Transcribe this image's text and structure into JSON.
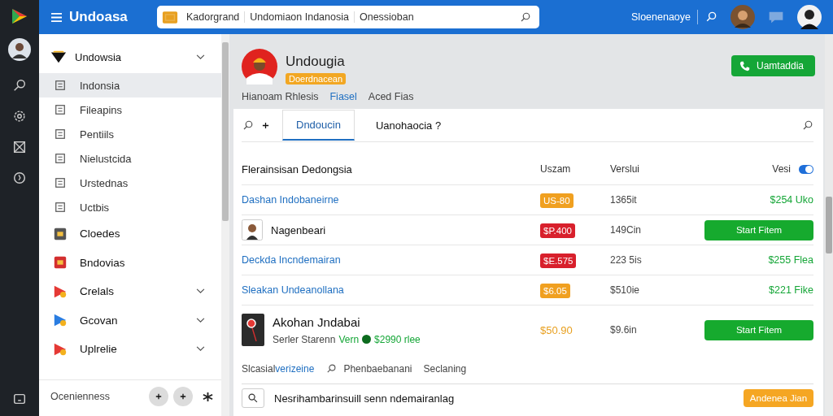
{
  "topbar": {
    "title": "Undoasa",
    "search_segments": [
      "Kadorgrand",
      "Undomiaon Indanosia",
      "Onessioban"
    ],
    "account_label": "Sloenenaoye"
  },
  "sidebar": {
    "header": "Undowsia",
    "items": [
      {
        "label": "Indonsia",
        "kind": "plain",
        "selected": true
      },
      {
        "label": "Fileapins",
        "kind": "plain",
        "selected": false
      },
      {
        "label": "Pentiils",
        "kind": "plain",
        "selected": false
      },
      {
        "label": "Nielustcida",
        "kind": "plain",
        "selected": false
      },
      {
        "label": "Urstednas",
        "kind": "plain",
        "selected": false
      },
      {
        "label": "Uctbis",
        "kind": "plain",
        "selected": false
      },
      {
        "label": "Cloedes",
        "kind": "app",
        "selected": false
      },
      {
        "label": "Bndovias",
        "kind": "app",
        "selected": false
      },
      {
        "label": "Crelals",
        "kind": "group",
        "selected": false
      },
      {
        "label": "Gcovan",
        "kind": "group",
        "selected": false
      },
      {
        "label": "Uplrelie",
        "kind": "group",
        "selected": false
      }
    ],
    "footer": "Ocenienness"
  },
  "profile": {
    "name": "Undougia",
    "tag": "Doerdnacean",
    "subtabs": [
      {
        "label": "Hianoam Rhlesis",
        "selected": false
      },
      {
        "label": "Fiasel",
        "selected": true
      },
      {
        "label": "Aced Fias",
        "selected": false
      }
    ],
    "action": "Uamtaddia"
  },
  "tabs": [
    {
      "label": "Dndoucin",
      "selected": true
    },
    {
      "label": "Uanohaocia ?",
      "selected": false
    }
  ],
  "table": {
    "columns": [
      "Flerainsisan Dedongsia",
      "Uszam",
      "Verslui",
      "Vesi"
    ],
    "toggle_on": true,
    "rows": [
      {
        "kind": "link",
        "name": "Dashan Indobaneirne",
        "price": "US-80",
        "color": "#f0a020",
        "col_3": "1365it",
        "end": "$254 Uko"
      },
      {
        "kind": "person",
        "name": "Nagenbeari",
        "price": "$P.400",
        "color": "#d8202c",
        "col_3": "149Cin",
        "end": "Start Fitem"
      },
      {
        "kind": "link",
        "name": "Deckda Incndemairan",
        "price": "$E.575",
        "color": "#d8202c",
        "col_3": "223 5is",
        "end": "$255 Flea"
      },
      {
        "kind": "link",
        "name": "Sleakan Undeanollana",
        "price": "$6.05",
        "color": "#f0a020",
        "col_3": "$510ie",
        "end": "$221 Fike"
      },
      {
        "kind": "feature",
        "name": "Akohan Jndabai",
        "sub": "Serler Starenn",
        "sub_link": "Vern",
        "sub_price": "$2990 rlee",
        "price": "$50.90",
        "col_3": "$9.6in",
        "end": "Start Fitem"
      }
    ]
  },
  "footer_links": [
    "Slcasial**verizeine**",
    "Phenbaebanani",
    "Seclaning"
  ],
  "bottom": {
    "placeholder": "Nesrihambarinsuill senn ndemairanlag",
    "button": "Andenea Jian"
  }
}
